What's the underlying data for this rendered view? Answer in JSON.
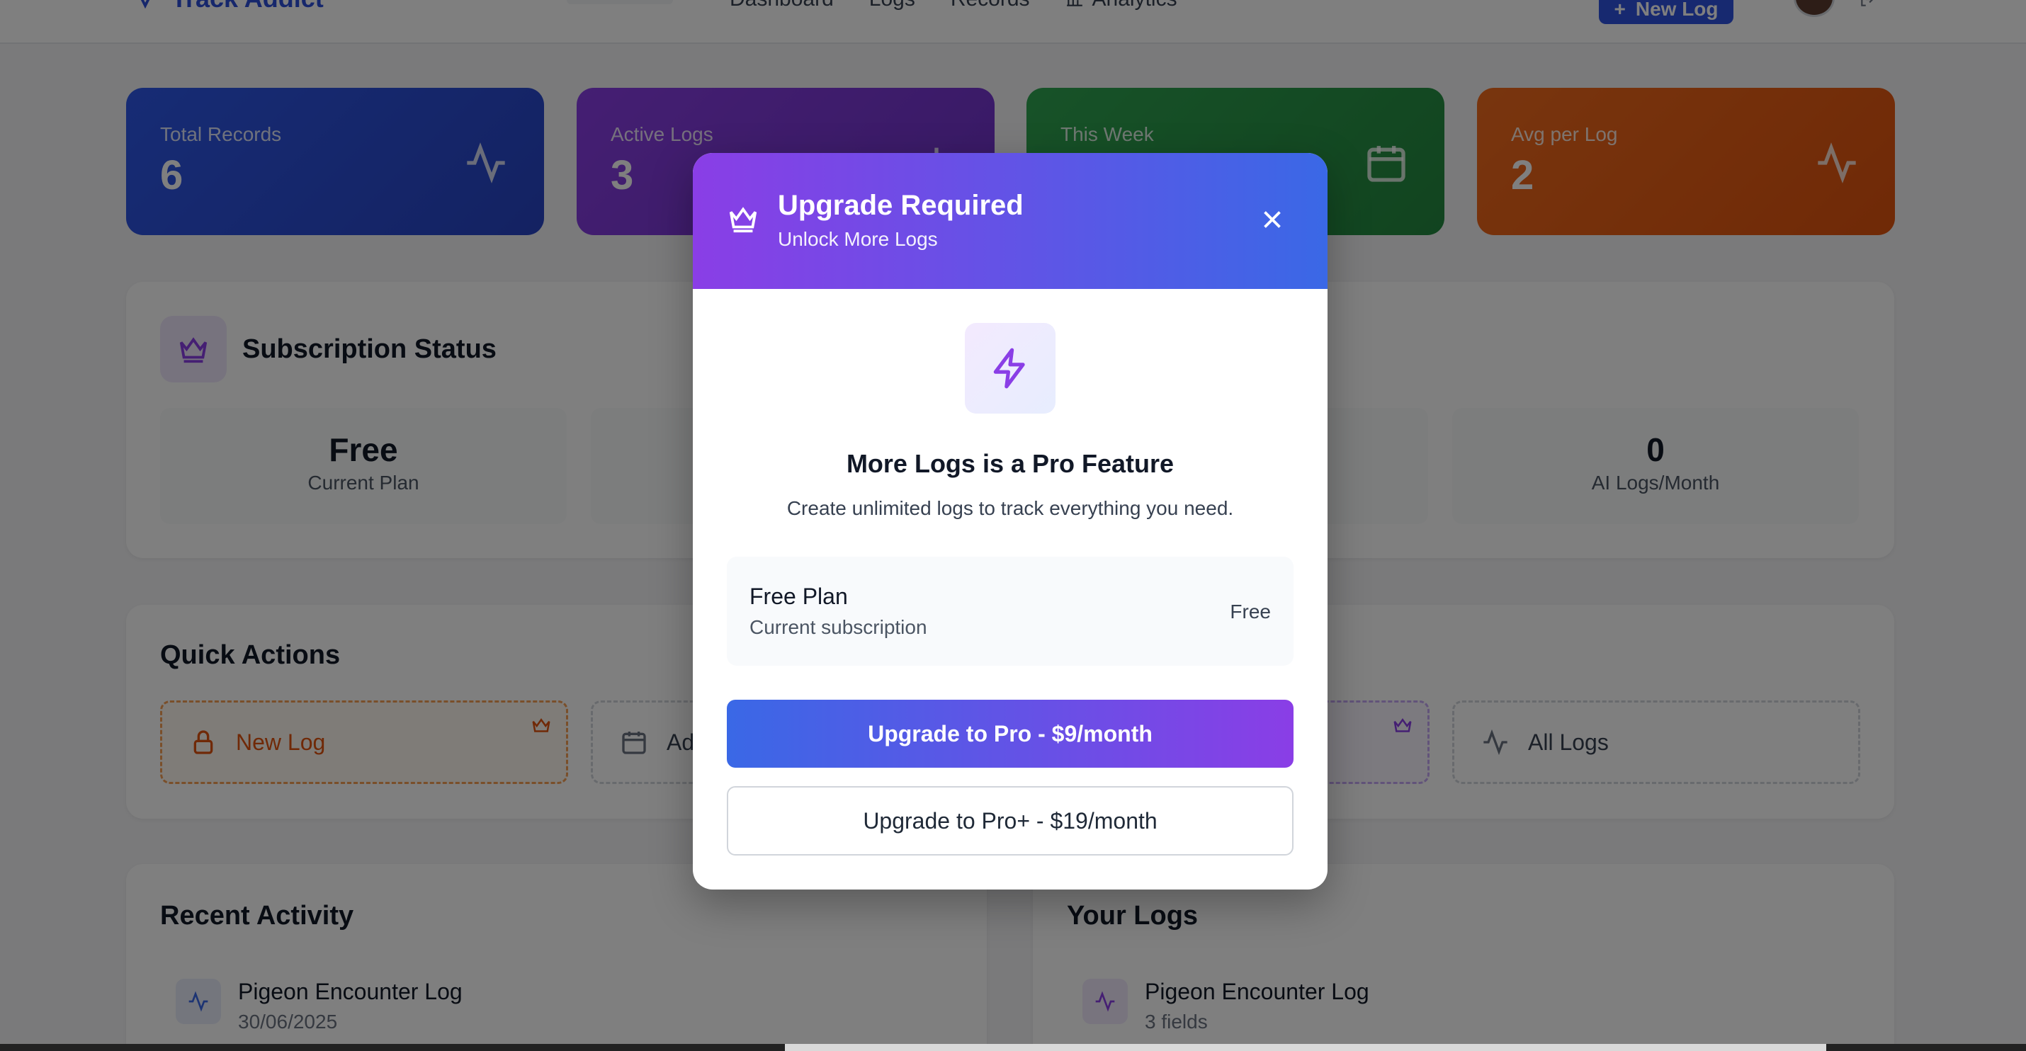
{
  "nav": {
    "brand": "Track Addict",
    "links": [
      "Dashboard",
      "Logs",
      "Records",
      "Analytics"
    ],
    "new_log_label": "New Log"
  },
  "stats": [
    {
      "label": "Total Records",
      "value": "6",
      "color": "#2e58ea",
      "icon": "activity-icon"
    },
    {
      "label": "Active Logs",
      "value": "3",
      "color": "#8a3ee6",
      "icon": "chart-icon"
    },
    {
      "label": "This Week",
      "value": "",
      "color": "#2fa551",
      "icon": "calendar-icon"
    },
    {
      "label": "Avg per Log",
      "value": "2",
      "color": "#f26b1d",
      "icon": "activity-icon"
    }
  ],
  "subscription": {
    "title": "Subscription Status",
    "metrics": [
      {
        "value": "Free",
        "label": "Current Plan"
      },
      {
        "value": "0",
        "label": "AI Logs/Month"
      }
    ]
  },
  "quick_actions": {
    "title": "Quick Actions",
    "items": [
      {
        "label": "New Log",
        "icon": "lock-icon",
        "locked": true
      },
      {
        "label": "Ad",
        "icon": "calendar-icon"
      },
      {
        "label": "",
        "icon": "crown-icon",
        "locked": true
      },
      {
        "label": "All Logs",
        "icon": "activity-icon"
      }
    ]
  },
  "recent_activity": {
    "title": "Recent Activity",
    "items": [
      {
        "title": "Pigeon Encounter Log",
        "sub": "30/06/2025"
      }
    ]
  },
  "your_logs": {
    "title": "Your Logs",
    "items": [
      {
        "title": "Pigeon Encounter Log",
        "sub": "3 fields"
      }
    ]
  },
  "modal": {
    "title": "Upgrade Required",
    "subtitle": "Unlock More Logs",
    "feature_title": "More Logs is a Pro Feature",
    "feature_desc": "Create unlimited logs to track everything you need.",
    "plan": {
      "name": "Free Plan",
      "sub": "Current subscription",
      "price": "Free"
    },
    "pro_button": "Upgrade to Pro - $9/month",
    "proplus_button": "Upgrade to Pro+ - $19/month",
    "header_gradient": [
      "#8a3ee6",
      "#3a68e6"
    ]
  }
}
